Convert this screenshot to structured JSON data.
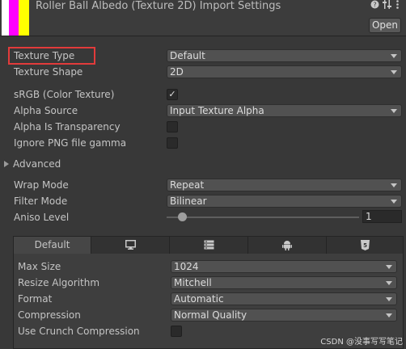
{
  "header": {
    "title": "Roller Ball Albedo (Texture 2D) Import Settings",
    "open_button": "Open",
    "icons": [
      "help-icon",
      "settings-icon",
      "menu-icon"
    ],
    "thumbnail_colors": [
      "#ffffff",
      "#ff00ff",
      "#ffff00"
    ]
  },
  "properties": {
    "texture_type": {
      "label": "Texture Type",
      "value": "Default"
    },
    "texture_shape": {
      "label": "Texture Shape",
      "value": "2D"
    },
    "srgb": {
      "label": "sRGB (Color Texture)",
      "checked": true,
      "check_glyph": "✓"
    },
    "alpha_source": {
      "label": "Alpha Source",
      "value": "Input Texture Alpha"
    },
    "alpha_is_transparency": {
      "label": "Alpha Is Transparency",
      "checked": false
    },
    "ignore_png_gamma": {
      "label": "Ignore PNG file gamma",
      "checked": false
    },
    "advanced": {
      "label": "Advanced",
      "expanded": false
    },
    "wrap_mode": {
      "label": "Wrap Mode",
      "value": "Repeat"
    },
    "filter_mode": {
      "label": "Filter Mode",
      "value": "Bilinear"
    },
    "aniso_level": {
      "label": "Aniso Level",
      "value": "1"
    }
  },
  "platform_tabs": {
    "items": [
      {
        "label": "Default",
        "icon": null,
        "active": true
      },
      {
        "label": "",
        "icon": "monitor-icon",
        "active": false
      },
      {
        "label": "",
        "icon": "server-icon",
        "active": false
      },
      {
        "label": "",
        "icon": "android-icon",
        "active": false
      },
      {
        "label": "",
        "icon": "html5-icon",
        "active": false
      }
    ]
  },
  "platform_settings": {
    "max_size": {
      "label": "Max Size",
      "value": "1024"
    },
    "resize_algorithm": {
      "label": "Resize Algorithm",
      "value": "Mitchell"
    },
    "format": {
      "label": "Format",
      "value": "Automatic"
    },
    "compression": {
      "label": "Compression",
      "value": "Normal Quality"
    },
    "use_crunch": {
      "label": "Use Crunch Compression",
      "checked": false
    }
  },
  "highlight_color": "#e23b3b",
  "watermark": "CSDN @没事写写笔记"
}
